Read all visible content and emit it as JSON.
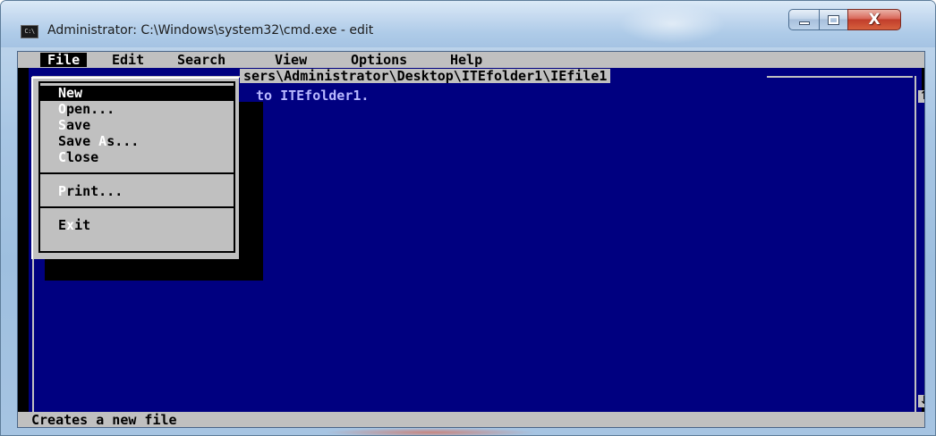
{
  "window": {
    "title": "Administrator: C:\\Windows\\system32\\cmd.exe - edit",
    "icon": "console-icon",
    "icon_label": "C:\\"
  },
  "caption_buttons": {
    "minimize_icon": "minimize-icon",
    "maximize_icon": "maximize-icon",
    "close_icon": "close-icon",
    "close_glyph": "X"
  },
  "menubar": {
    "items": [
      "File",
      "Edit",
      "Search",
      "View",
      "Options",
      "Help"
    ]
  },
  "editor": {
    "file_path": "sers\\Administrator\\Desktop\\ITEfolder1\\IEfile1",
    "content_line": "to ITEfolder1.",
    "scroll_up_glyph": "↑",
    "scroll_down_glyph": "↓"
  },
  "file_menu": {
    "items": [
      {
        "label_rest": "ew",
        "hotkey": "N",
        "selected": true
      },
      {
        "hotkey": "O",
        "label_rest": "pen..."
      },
      {
        "hotkey": "S",
        "label_rest": "ave"
      },
      {
        "label_pre": "Save ",
        "hotkey": "A",
        "label_rest": "s..."
      },
      {
        "hotkey": "C",
        "label_rest": "lose"
      },
      {
        "hotkey": "P",
        "label_rest": "rint..."
      },
      {
        "label_pre": "E",
        "hotkey": "x",
        "label_rest": "it"
      }
    ]
  },
  "statusbar": {
    "text": "Creates a new file"
  },
  "colors": {
    "editor_background": "#000080",
    "menu_background": "#c0c0c0",
    "text_on_blue": "#b8b8ff"
  }
}
